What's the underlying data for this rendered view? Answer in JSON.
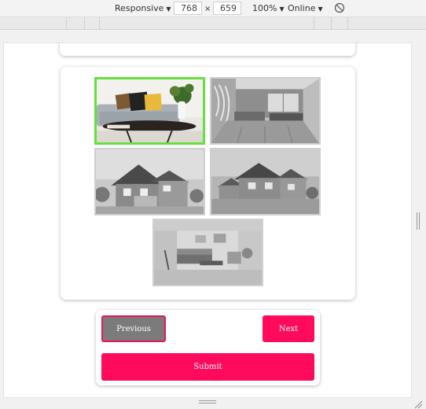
{
  "toolbar": {
    "device": "Responsive",
    "width": "768",
    "times": "×",
    "height": "659",
    "zoom": "100%",
    "network": "Online"
  },
  "gallery": {
    "images": [
      {
        "name": "living-room-color",
        "selected": true
      },
      {
        "name": "living-room-grayscale",
        "selected": false
      },
      {
        "name": "house-front-grayscale",
        "selected": false
      },
      {
        "name": "house-side-grayscale",
        "selected": false
      },
      {
        "name": "lounge-grayscale",
        "selected": false
      }
    ]
  },
  "nav": {
    "previous_label": "Previous",
    "next_label": "Next",
    "submit_label": "Submit"
  },
  "colors": {
    "accent": "#ff0a5c",
    "selected_border": "#66e03a",
    "previous_bg": "#7b7b7b"
  }
}
